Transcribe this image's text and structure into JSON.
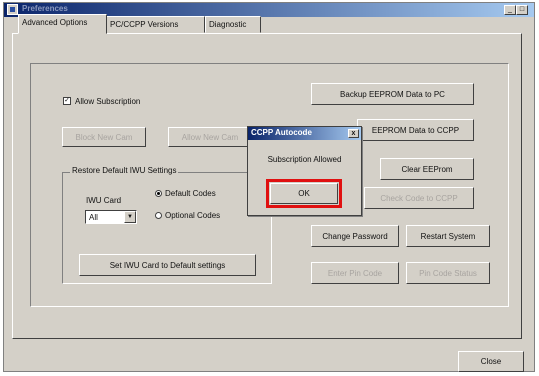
{
  "window": {
    "title": "Preferences"
  },
  "title_buttons": {
    "minimize": "_",
    "maximize": "□",
    "close": "×"
  },
  "tabs": [
    {
      "label": "Advanced Options"
    },
    {
      "label": "PC/CCPP Versions"
    },
    {
      "label": "Diagnostic"
    }
  ],
  "subscription": {
    "checkbox_label": "Allow Subscription",
    "checked": "✓"
  },
  "left_buttons": {
    "block_new_cam": "Block New Cam",
    "allow_new_cam": "Allow New Cam"
  },
  "group": {
    "legend": "Restore Default IWU Settings",
    "iwu_card_label": "IWU Card",
    "combo_value": "All",
    "combo_arrow": "▼",
    "radio_default": "Default Codes",
    "radio_optional": "Optional Codes",
    "set_button": "Set IWU Card to Default settings"
  },
  "right_buttons": {
    "backup": "Backup EEPROM Data to PC",
    "eeprom_ccpp": "EEPROM Data to CCPP",
    "clear": "Clear EEProm",
    "check_code": "Check Code to CCPP",
    "change_password": "Change Password",
    "restart": "Restart System",
    "enter_pin": "Enter Pin Code",
    "pin_status": "Pin Code Status"
  },
  "dialog": {
    "title": "CCPP Autocode",
    "close": "x",
    "message": "Subscription Allowed",
    "ok": "OK"
  },
  "footer": {
    "close": "Close"
  },
  "colors": {
    "face": "#d4d0c8",
    "titlebar": "#0a246a",
    "highlight": "#e01010"
  }
}
